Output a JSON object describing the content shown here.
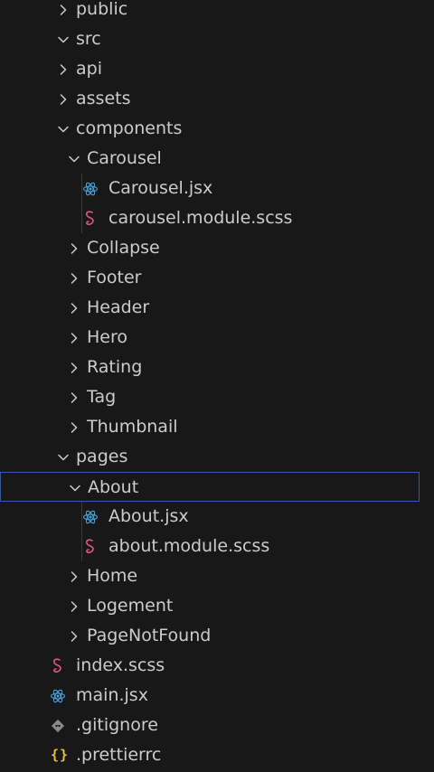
{
  "tree": {
    "items": [
      {
        "label": "public",
        "kind": "folder",
        "state": "collapsed",
        "depth": 0,
        "icon": "chevron-right-icon"
      },
      {
        "label": "src",
        "kind": "folder",
        "state": "expanded",
        "depth": 0,
        "icon": "chevron-down-icon"
      },
      {
        "label": "api",
        "kind": "folder",
        "state": "collapsed",
        "depth": 1,
        "icon": "chevron-right-icon"
      },
      {
        "label": "assets",
        "kind": "folder",
        "state": "collapsed",
        "depth": 1,
        "icon": "chevron-right-icon"
      },
      {
        "label": "components",
        "kind": "folder",
        "state": "expanded",
        "depth": 1,
        "icon": "chevron-down-icon"
      },
      {
        "label": "Carousel",
        "kind": "folder",
        "state": "expanded",
        "depth": 2,
        "icon": "chevron-down-icon"
      },
      {
        "label": "Carousel.jsx",
        "kind": "file",
        "filetype": "jsx",
        "depth": 3,
        "icon": "react-icon"
      },
      {
        "label": "carousel.module.scss",
        "kind": "file",
        "filetype": "scss",
        "depth": 3,
        "icon": "sass-icon"
      },
      {
        "label": "Collapse",
        "kind": "folder",
        "state": "collapsed",
        "depth": 2,
        "icon": "chevron-right-icon"
      },
      {
        "label": "Footer",
        "kind": "folder",
        "state": "collapsed",
        "depth": 2,
        "icon": "chevron-right-icon"
      },
      {
        "label": "Header",
        "kind": "folder",
        "state": "collapsed",
        "depth": 2,
        "icon": "chevron-right-icon"
      },
      {
        "label": "Hero",
        "kind": "folder",
        "state": "collapsed",
        "depth": 2,
        "icon": "chevron-right-icon"
      },
      {
        "label": "Rating",
        "kind": "folder",
        "state": "collapsed",
        "depth": 2,
        "icon": "chevron-right-icon"
      },
      {
        "label": "Tag",
        "kind": "folder",
        "state": "collapsed",
        "depth": 2,
        "icon": "chevron-right-icon"
      },
      {
        "label": "Thumbnail",
        "kind": "folder",
        "state": "collapsed",
        "depth": 2,
        "icon": "chevron-right-icon"
      },
      {
        "label": "pages",
        "kind": "folder",
        "state": "expanded",
        "depth": 1,
        "icon": "chevron-down-icon"
      },
      {
        "label": "About",
        "kind": "folder",
        "state": "expanded",
        "depth": 2,
        "icon": "chevron-down-icon",
        "selected": true
      },
      {
        "label": "About.jsx",
        "kind": "file",
        "filetype": "jsx",
        "depth": 3,
        "icon": "react-icon"
      },
      {
        "label": "about.module.scss",
        "kind": "file",
        "filetype": "scss",
        "depth": 3,
        "icon": "sass-icon"
      },
      {
        "label": "Home",
        "kind": "folder",
        "state": "collapsed",
        "depth": 2,
        "icon": "chevron-right-icon"
      },
      {
        "label": "Logement",
        "kind": "folder",
        "state": "collapsed",
        "depth": 2,
        "icon": "chevron-right-icon"
      },
      {
        "label": "PageNotFound",
        "kind": "folder",
        "state": "collapsed",
        "depth": 2,
        "icon": "chevron-right-icon"
      },
      {
        "label": "index.scss",
        "kind": "file",
        "filetype": "scss",
        "depth": 1,
        "icon": "sass-icon"
      },
      {
        "label": "main.jsx",
        "kind": "file",
        "filetype": "jsx",
        "depth": 1,
        "icon": "react-icon"
      },
      {
        "label": ".gitignore",
        "kind": "file",
        "filetype": "git",
        "depth": 0,
        "icon": "git-icon"
      },
      {
        "label": ".prettierrc",
        "kind": "file",
        "filetype": "json",
        "depth": 0,
        "icon": "json-braces-icon"
      }
    ]
  },
  "colors": {
    "background": "#181818",
    "text": "#cccccc",
    "react_icon": "#4aa3df",
    "sass_icon": "#e0577f",
    "git_icon": "#8a8a8a",
    "json_icon": "#e8c13a",
    "selection_border": "#2f5d9e"
  }
}
